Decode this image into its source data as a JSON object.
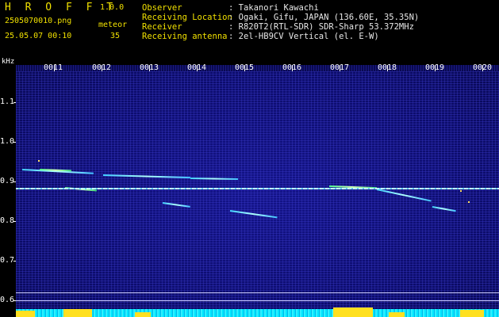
{
  "header": {
    "app_name": "H R O F F T",
    "version": "1.0.0",
    "filename": "2505070010.png",
    "datetime": "25.05.07 00:10",
    "meteor_label": "meteor",
    "meteor_count": "35",
    "info": [
      {
        "label": "Observer",
        "value": ": Takanori Kawachi"
      },
      {
        "label": "Receiving Location",
        "value": ": Ogaki, Gifu, JAPAN (136.60E, 35.35N)"
      },
      {
        "label": "Receiver",
        "value": ": R820T2(RTL-SDR) SDR-Sharp 53.372MHz"
      },
      {
        "label": "Receiving antenna",
        "value": ": 2el-HB9CV Vertical (el. E-W)"
      }
    ]
  },
  "spectrogram": {
    "y_unit": "kHz",
    "y_ticks": [
      "1.1",
      "1.0",
      "0.9",
      "0.8",
      "0.7",
      "0.6"
    ],
    "x_ticks": [
      "0011",
      "0012",
      "0013",
      "0014",
      "0015",
      "0016",
      "0017",
      "0018",
      "0019",
      "0020"
    ],
    "colors": {
      "background": "#0c0c6a",
      "carrier": "#b8ffff",
      "baseline": "#00e5ff",
      "peak": "#ffe020",
      "header_yellow": "#f0e000"
    }
  }
}
